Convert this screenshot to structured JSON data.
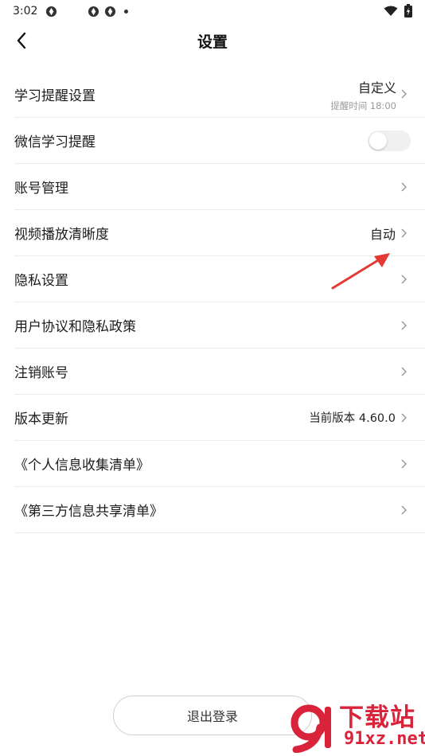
{
  "status_bar": {
    "time": "3:02"
  },
  "header": {
    "title": "设置"
  },
  "rows": [
    {
      "label": "学习提醒设置",
      "value": "自定义",
      "sub": "提醒时间 18:00"
    },
    {
      "label": "微信学习提醒",
      "toggle_on": false
    },
    {
      "label": "账号管理"
    },
    {
      "label": "视频播放清晰度",
      "value": "自动"
    },
    {
      "label": "隐私设置"
    },
    {
      "label": "用户协议和隐私政策"
    },
    {
      "label": "注销账号"
    },
    {
      "label": "版本更新",
      "value": "当前版本 4.60.0"
    },
    {
      "label": "《个人信息收集清单》"
    },
    {
      "label": "《第三方信息共享清单》"
    }
  ],
  "footer": {
    "logout_label": "退出登录"
  },
  "watermark": {
    "top": "下载站",
    "bottom": "91xz.net"
  },
  "colors": {
    "accent_red": "#d8233b",
    "divider": "#ebebeb",
    "toggle_off": "#f0f0f0"
  },
  "icons": [
    "back-arrow-icon",
    "chevron-right-icon",
    "wifi-icon",
    "battery-icon"
  ]
}
